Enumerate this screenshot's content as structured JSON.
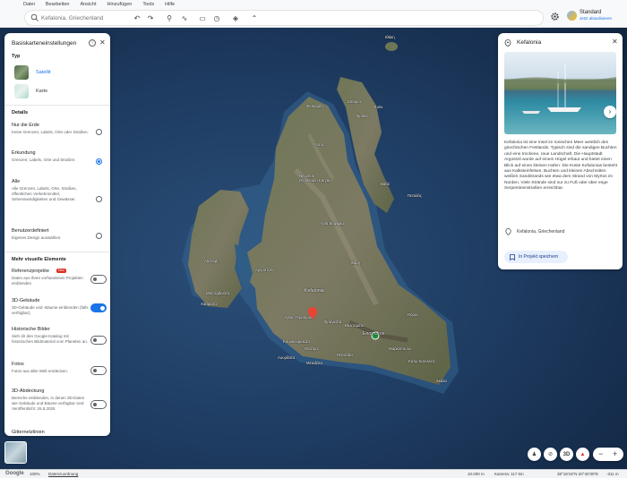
{
  "menu": [
    "Datei",
    "Bearbeiten",
    "Ansicht",
    "Hinzufügen",
    "Tools",
    "Hilfe"
  ],
  "search": {
    "placeholder": "Kefalonia, Griechenland"
  },
  "account": {
    "name": "Standard",
    "link": "Jetzt aktualisieren"
  },
  "left_panel": {
    "title": "Basiskarteneinstellungen",
    "type_section": "Typ",
    "types": [
      {
        "label": "Satellit",
        "selected": true
      },
      {
        "label": "Karte",
        "selected": false
      }
    ],
    "details_section": "Details",
    "details": [
      {
        "title": "Nur die Erde",
        "desc": "Keine Grenzen, Labels, Orte oder Straßen.",
        "selected": false
      },
      {
        "title": "Erkundung",
        "desc": "Grenzen, Labels, Orte und Straßen.",
        "selected": true
      },
      {
        "title": "Alle",
        "desc": "Alle Grenzen, Labels, Orte, Straßen, öffentlichen Verkehrsmittel, Sehenswürdigkeiten und Gewässer.",
        "selected": false
      },
      {
        "title": "Benutzerdefiniert",
        "desc": "Eigenes Design auswählen.",
        "selected": false
      }
    ],
    "visual_section": "Mehr visuelle Elemente",
    "visual": [
      {
        "title": "Referenzprojekte",
        "badge": "Neu",
        "desc": "Daten aus Ihren vorhandenen Projekten einblenden",
        "on": false
      },
      {
        "title": "3D-Gebäude",
        "desc": "3D-Gebäude und -Bäume einblenden (falls verfügbar).",
        "on": true
      },
      {
        "title": "Historische Bilder",
        "desc": "Sieh dir den Google-Katalog mit historischen Bildmaterial vom Planeten an.",
        "on": false
      },
      {
        "title": "Fotos",
        "desc": "Fotos aus aller Welt entdecken.",
        "on": false
      },
      {
        "title": "3D-Abdeckung",
        "desc": "Bereiche einblenden, in denen 3D-Daten wie Gebäude und Bäume verfügbar sind Veröffentlicht: 25.8.2025",
        "on": false
      },
      {
        "title": "Gitternetzlinien",
        "desc": "",
        "on": false
      }
    ]
  },
  "info_panel": {
    "title": "Kefalonia",
    "description": "Kefalonia ist eine Insel im Ionischen Meer westlich des griechischen Festlands. Typisch sind die sandigen Buchten und eine trockene, raue Landschaft. Die Hauptstadt Argostoli wurde auf einem Hügel erbaut und bietet einen Blick auf einen kleinen Hafen. Die Küste Kefalonias besteht aus Kalksteinfelsen, Buchten und kleinen Abschnitten weißen Sandstrands wie etwa dem Strand von Myrtos im Norden. Viele Strände sind nur zu Fuß oder über enge Serpentinenstraßen erreichbar.",
    "location": "Kefalonia, Griechenland",
    "save_label": "In Projekt speichern"
  },
  "map_labels": {
    "island": "Kefalonia",
    "mountain": "Enos Oros",
    "neochori": "Neochori\n(Komitaton Karyas)",
    "places": [
      "Ιθάκη",
      "Σταυρός",
      "Κιόνι",
      "Φρίκες",
      "Βαθύ",
      "Πεταλάς",
      "Φισκάρδο",
      "Άσος",
      "Αγία Ευφημία",
      "Σάμη",
      "Πόρος",
      "Σκάλα",
      "Αργοστόλι",
      "Ληξούρι",
      "Κάτω Κατελειός",
      "Πεσσάδα",
      "Κουρκουμελάτα",
      "Μαρκόπουλο",
      "Πάστρα",
      "Άγιος Γεράσιμος",
      "Χαβριάτα",
      "Μάντζαβινάτα",
      "Φραγκάτα",
      "Βαλσαμάτα",
      "Μεταξάτα",
      "Λουρδάτα"
    ]
  },
  "status_bar": {
    "google": "Google",
    "zoom": "100%",
    "data_label": "Datenzuordnung",
    "scale": "10.000 m",
    "camera": "Kamera: 117 km",
    "coords": "38°18'16\"N 20°40'30\"E",
    "elev": "-311 m"
  },
  "controls": {
    "threed": "3D"
  }
}
